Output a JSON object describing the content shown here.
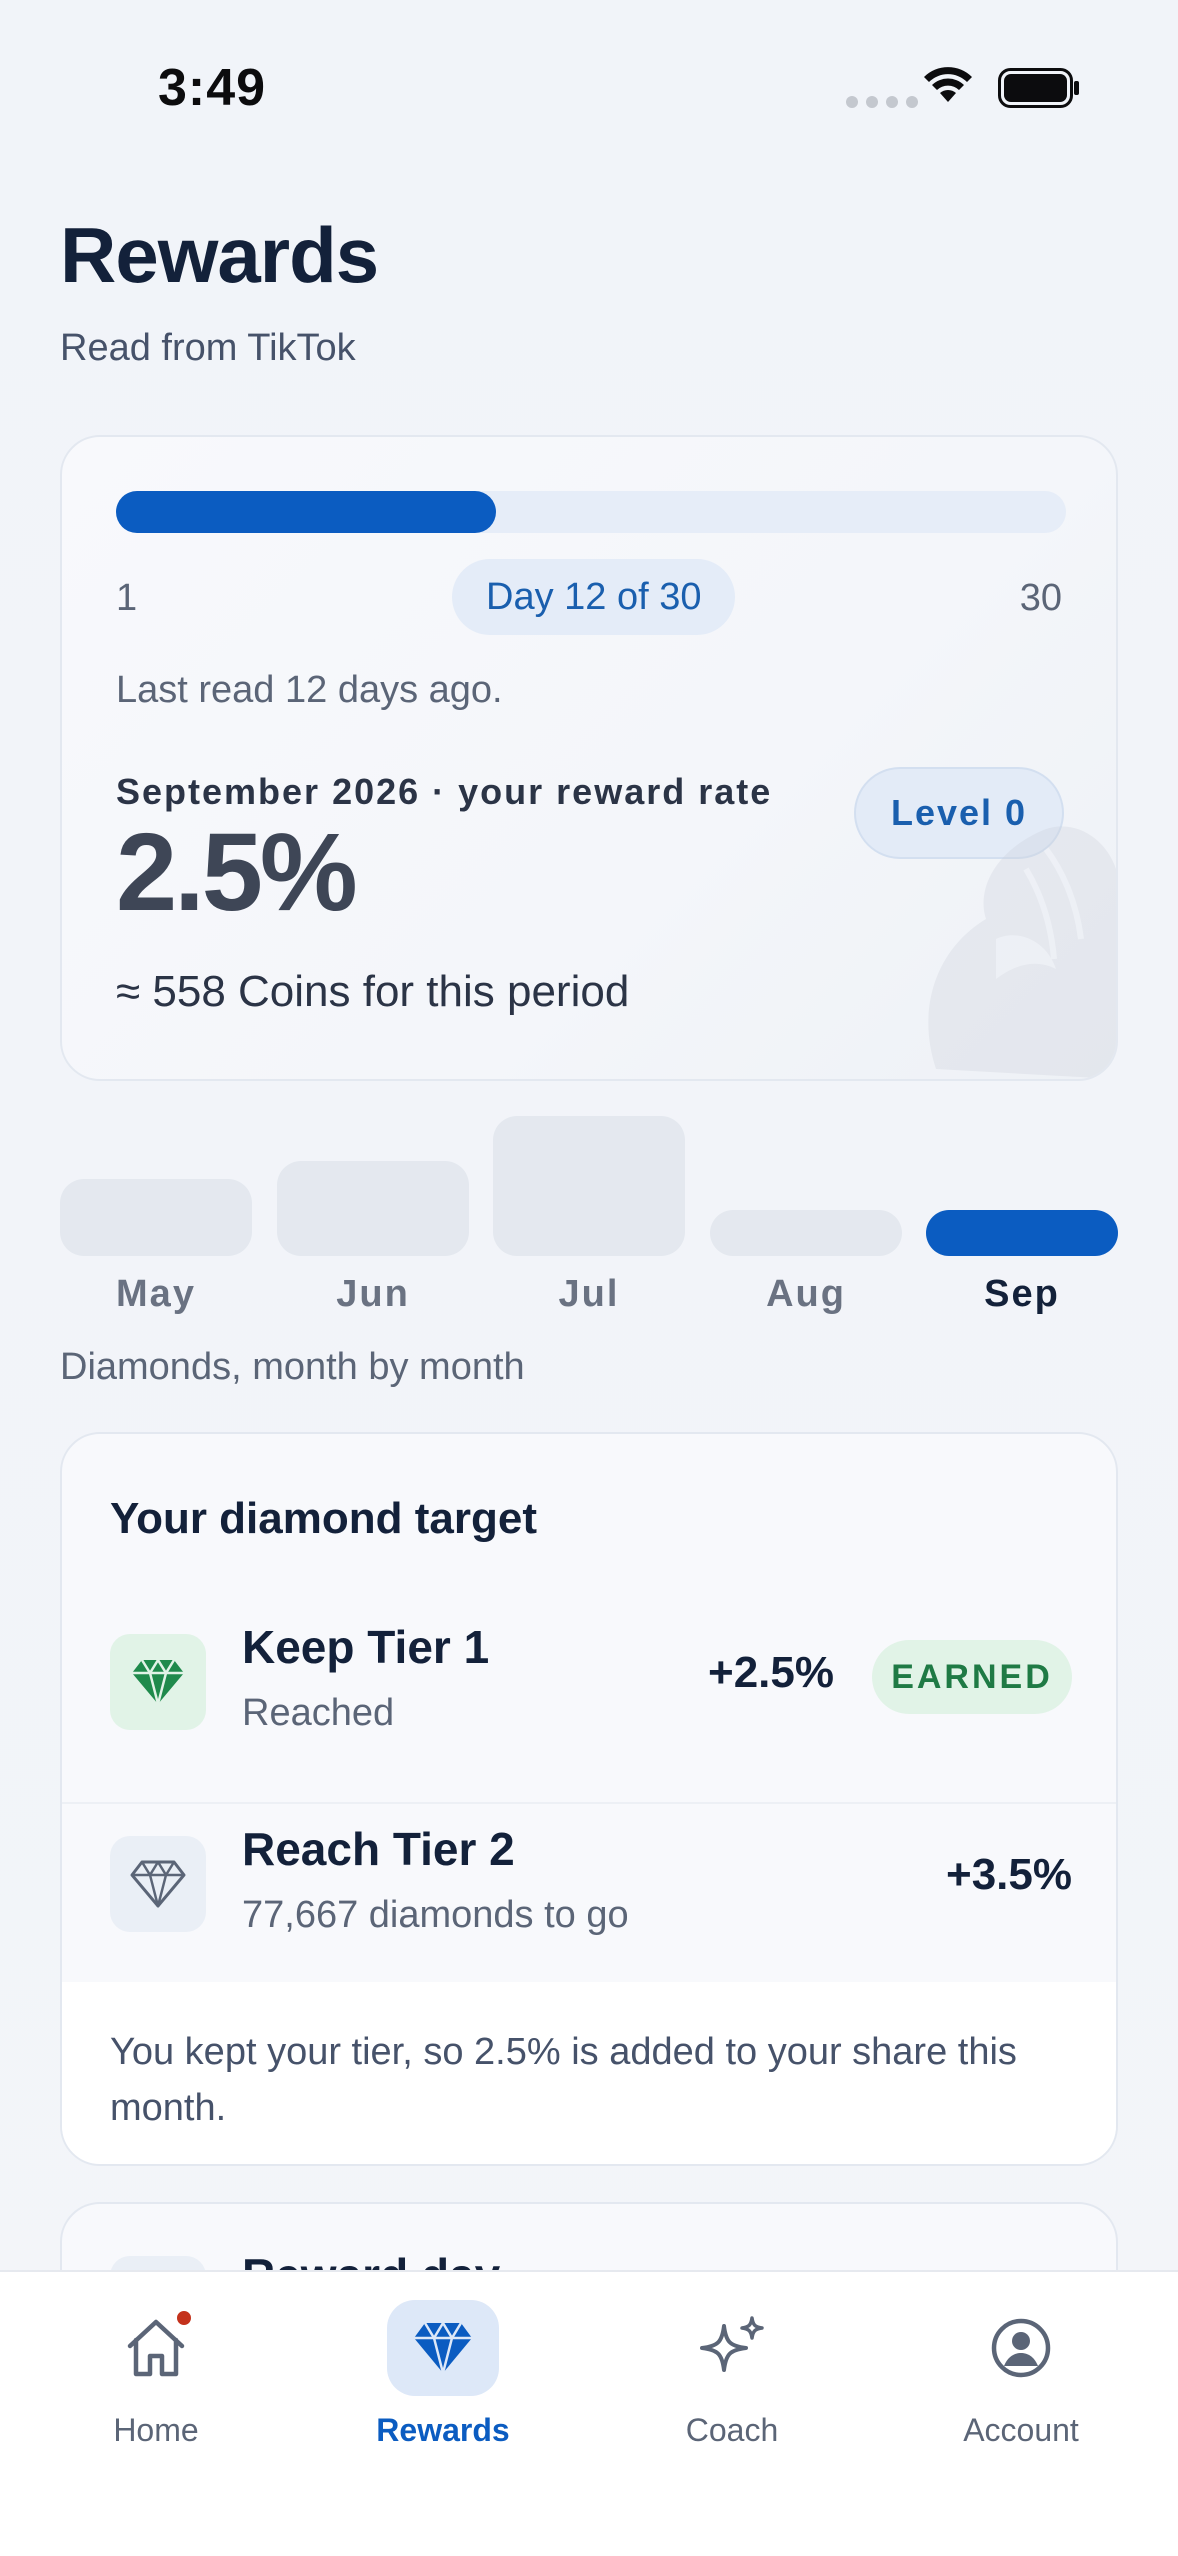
{
  "status_bar": {
    "time": "3:49"
  },
  "header": {
    "title": "Rewards",
    "subtitle": "Read from TikTok"
  },
  "cycle": {
    "range_start": "1",
    "range_end": "30",
    "day_label": "Day 12 of 30",
    "progress_fraction": 0.4,
    "last_read": "Last read 12 days ago.",
    "rate_caption": "September 2026 · your reward rate",
    "rate_value": "2.5%",
    "level": "Level 0",
    "coins_estimate": "≈ 558 Coins for this period"
  },
  "months": {
    "caption": "Diamonds, month by month",
    "items": [
      {
        "label": "May",
        "level": 0.55,
        "current": false
      },
      {
        "label": "Jun",
        "level": 0.68,
        "current": false
      },
      {
        "label": "Jul",
        "level": 1.0,
        "current": false
      },
      {
        "label": "Aug",
        "level": 0.33,
        "current": false
      },
      {
        "label": "Sep",
        "level": 0.33,
        "current": true
      }
    ]
  },
  "target": {
    "title": "Your diamond target",
    "tiers": [
      {
        "name": "Keep Tier 1",
        "status": "Reached",
        "bonus": "+2.5%",
        "badge": "EARNED",
        "icon": "diamond-icon"
      },
      {
        "name": "Reach Tier 2",
        "status": "77,667 diamonds to go",
        "bonus": "+3.5%",
        "icon": "diamond-outline-icon"
      }
    ],
    "note": "You kept your tier, so 2.5% is added to your share this month."
  },
  "next_card": {
    "title": "Reward day"
  },
  "tabs": [
    {
      "label": "Home",
      "icon": "home-icon",
      "active": false,
      "notification": true
    },
    {
      "label": "Rewards",
      "icon": "diamond-icon",
      "active": true
    },
    {
      "label": "Coach",
      "icon": "sparkle-icon",
      "active": false
    },
    {
      "label": "Account",
      "icon": "account-icon",
      "active": false
    }
  ],
  "colors": {
    "accent": "#0b5cc1",
    "earned": "#1f7a45",
    "earned_bg": "#e1f3e7",
    "notification": "#c4321c"
  }
}
